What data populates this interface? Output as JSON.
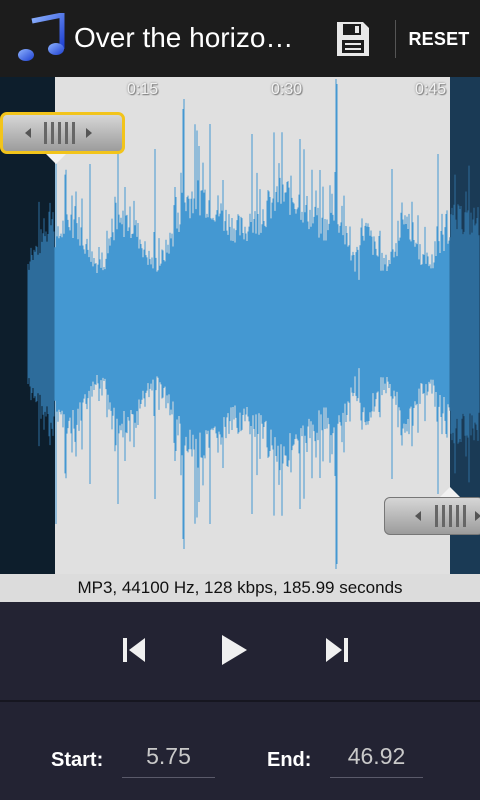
{
  "actionbar": {
    "title": "Over the horizo…",
    "app_icon": "music-note-icon",
    "save_icon": "floppy-disk-icon",
    "reset_label": "RESET"
  },
  "waveform": {
    "time_labels": [
      "0:15",
      "0:30",
      "0:45"
    ],
    "start_marker_icon": "drag-handle-icon",
    "end_marker_icon": "drag-handle-icon",
    "colors": {
      "wave": "#4498d2",
      "selection_bg": "#e0e0e0",
      "outside_bg": "#0d1e2c",
      "marker_focus": "#f2c41b"
    }
  },
  "info": {
    "text": "MP3, 44100 Hz, 128 kbps, 185.99 seconds"
  },
  "transport": {
    "prev_icon": "skip-previous-icon",
    "play_icon": "play-icon",
    "next_icon": "skip-next-icon"
  },
  "trim": {
    "start_label": "Start:",
    "start_value": "5.75",
    "end_label": "End:",
    "end_value": "46.92"
  }
}
